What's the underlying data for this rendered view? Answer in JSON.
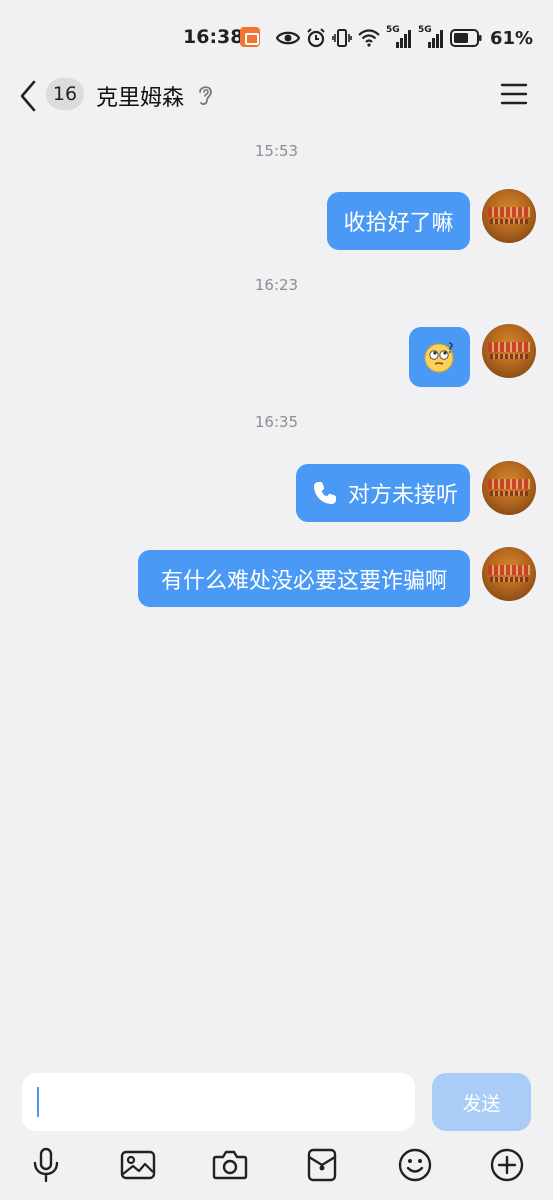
{
  "status_bar": {
    "time": "16:38",
    "battery": "61%",
    "network_label_1": "5G",
    "network_label_2": "5G"
  },
  "header": {
    "unread_count": "16",
    "title": "克里姆森"
  },
  "messages": [
    {
      "type": "timestamp",
      "text": "15:53"
    },
    {
      "type": "text",
      "sender": "me",
      "text": "收拾好了嘛"
    },
    {
      "type": "timestamp",
      "text": "16:23"
    },
    {
      "type": "emoji",
      "sender": "me",
      "emoji": "🙄"
    },
    {
      "type": "timestamp",
      "text": "16:35"
    },
    {
      "type": "call",
      "sender": "me",
      "text": "对方未接听"
    },
    {
      "type": "text",
      "sender": "me",
      "text": "有什么难处没必要这要诈骗啊"
    }
  ],
  "input": {
    "value": "",
    "send_label": "发送"
  },
  "toolbar": {
    "items": [
      "microphone-icon",
      "image-icon",
      "camera-icon",
      "red-packet-icon",
      "emoji-icon",
      "plus-icon"
    ]
  },
  "colors": {
    "bubble": "#4a9af5",
    "background": "#f1f1f3",
    "send_disabled": "#a9cdf6"
  }
}
